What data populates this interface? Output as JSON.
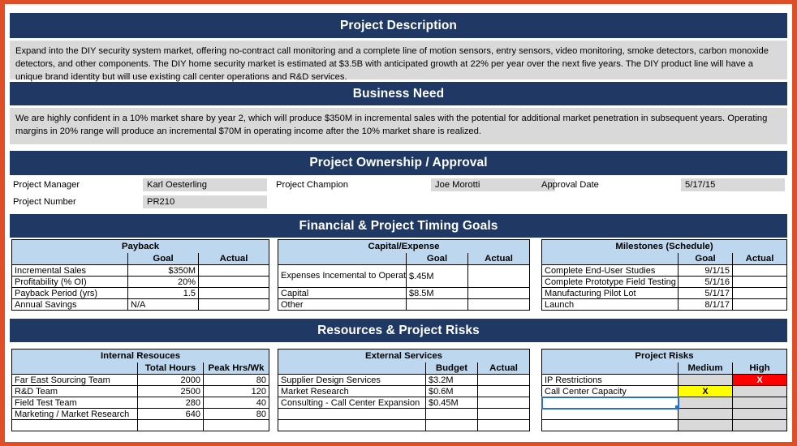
{
  "colors": {
    "frame": "#E04E27",
    "section_bar": "#1F3864",
    "table_header": "#BDD7EE",
    "panel_gray": "#D9D9D9",
    "risk_high": "#FF0000",
    "risk_medium": "#FFFF00",
    "selection": "#2C6FC9"
  },
  "sections": {
    "project_description": {
      "title": "Project Description",
      "body": "Expand into the DIY security system market, offering no-contract call monitoring and a complete line of motion sensors, entry sensors, video monitoring, smoke detectors, carbon monoxide detectors, and other components.  The DIY home security market is estimated at $3.5B with anticipated growth at 22%  per year over the next five years.  The DIY product line will have a unique brand identity but will use existing call center operations and R&D services."
    },
    "business_need": {
      "title": "Business Need",
      "body": "We are highly confident in a 10% market share by year 2, which will produce $350M in incremental sales with the potential for additional market penetration in subsequent years.  Operating margins in 20% range will produce an incremental $70M in operating income after the 10% market share is realized."
    },
    "ownership": {
      "title": "Project Ownership / Approval",
      "fields": [
        {
          "label": "Project Manager",
          "value": "Karl Oesterling"
        },
        {
          "label": "Project Champion",
          "value": "Joe Morotti"
        },
        {
          "label": "Approval Date",
          "value": "5/17/15"
        },
        {
          "label": "Project Number",
          "value": "PR210"
        }
      ]
    },
    "financial": {
      "title": "Financial & Project Timing Goals"
    },
    "resources": {
      "title": "Resources & Project Risks"
    }
  },
  "tables": {
    "payback": {
      "title": "Payback",
      "columns": [
        "",
        "Goal",
        "Actual"
      ],
      "rows": [
        {
          "label": "Incremental Sales",
          "goal": "$350M",
          "goal_align": "num",
          "actual": ""
        },
        {
          "label": "Profitability (% OI)",
          "goal": "20%",
          "goal_align": "num",
          "actual": ""
        },
        {
          "label": "Payback Period (yrs)",
          "goal": "1.5",
          "goal_align": "num",
          "actual": ""
        },
        {
          "label": "Annual Savings",
          "goal": "N/A",
          "goal_align": "lft",
          "actual": ""
        }
      ]
    },
    "capital_expense": {
      "title": "Capital/Expense",
      "columns": [
        "",
        "Goal",
        "Actual"
      ],
      "rows": [
        {
          "label": "Expenses Incemental to Operating Budget",
          "goal": "$.45M",
          "goal_align": "lft",
          "actual": "",
          "tall": true
        },
        {
          "label": "Capital",
          "goal": "$8.5M",
          "goal_align": "lft",
          "actual": ""
        },
        {
          "label": "Other",
          "goal": "",
          "goal_align": "lft",
          "actual": ""
        }
      ]
    },
    "milestones": {
      "title": "Milestones (Schedule)",
      "columns": [
        "",
        "Goal",
        "Actual"
      ],
      "rows": [
        {
          "label": "Complete End-User Studies",
          "goal": "9/1/15",
          "goal_align": "num",
          "actual": ""
        },
        {
          "label": "Complete Prototype Field Testing",
          "goal": "5/1/16",
          "goal_align": "num",
          "actual": ""
        },
        {
          "label": "Manufacturing Pilot Lot",
          "goal": "5/1/17",
          "goal_align": "num",
          "actual": ""
        },
        {
          "label": "Launch",
          "goal": "8/1/17",
          "goal_align": "num",
          "actual": ""
        }
      ]
    },
    "internal_resources": {
      "title": "Internal Resouces",
      "columns": [
        "",
        "Total Hours",
        "Peak Hrs/Wk"
      ],
      "rows": [
        {
          "label": "Far East Sourcing Team",
          "total_hours": "2000",
          "peak": "80"
        },
        {
          "label": "R&D Team",
          "total_hours": "2500",
          "peak": "120"
        },
        {
          "label": "Field Test Team",
          "total_hours": "280",
          "peak": "40"
        },
        {
          "label": "Marketing / Market Research",
          "total_hours": "640",
          "peak": "80"
        },
        {
          "label": "",
          "total_hours": "",
          "peak": ""
        }
      ]
    },
    "external_services": {
      "title": "External Services",
      "columns": [
        "",
        "Budget",
        "Actual"
      ],
      "rows": [
        {
          "label": "Supplier Design Services",
          "budget": "$3.2M",
          "actual": ""
        },
        {
          "label": "Market Research",
          "budget": "$0.6M",
          "actual": ""
        },
        {
          "label": "Consulting - Call Center Expansion",
          "budget": "$0.45M",
          "actual": ""
        },
        {
          "label": "",
          "budget": "",
          "actual": ""
        },
        {
          "label": "",
          "budget": "",
          "actual": ""
        }
      ]
    },
    "project_risks": {
      "title": "Project Risks",
      "columns": [
        "",
        "Medium",
        "High"
      ],
      "rows": [
        {
          "label": "IP Restrictions",
          "medium": "",
          "medium_state": "gray",
          "high": "X",
          "high_state": "red"
        },
        {
          "label": "Call Center Capacity",
          "medium": "X",
          "medium_state": "yellow",
          "high": "",
          "high_state": "gray"
        },
        {
          "label": "",
          "medium": "",
          "medium_state": "gray",
          "high": "",
          "high_state": "gray",
          "selected": true
        },
        {
          "label": "",
          "medium": "",
          "medium_state": "gray",
          "high": "",
          "high_state": "gray"
        },
        {
          "label": "",
          "medium": "",
          "medium_state": "gray",
          "high": "",
          "high_state": "gray"
        }
      ]
    }
  }
}
